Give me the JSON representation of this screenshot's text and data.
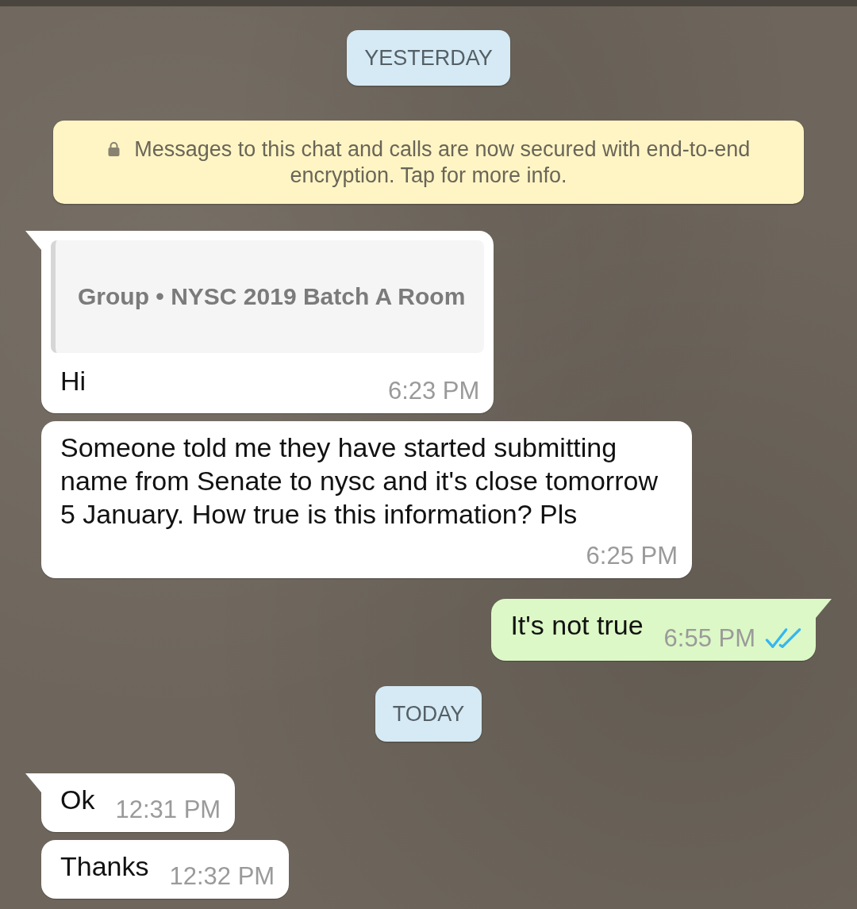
{
  "items": [
    {
      "kind": "date",
      "label": "YESTERDAY"
    },
    {
      "kind": "notice",
      "text": "Messages to this chat and calls are now secured with end-to-end encryption. Tap for more info."
    },
    {
      "kind": "message",
      "outgoing": false,
      "tail": true,
      "quote": "Group • NYSC 2019 Batch A Room",
      "text": "Hi",
      "time": "6:23 PM"
    },
    {
      "kind": "message",
      "outgoing": false,
      "tail": false,
      "text": "Someone told me they have started submitting name from Senate to nysc and it's close tomorrow 5 January. How true is this information? Pls",
      "time": "6:25 PM"
    },
    {
      "kind": "message",
      "outgoing": true,
      "tail": true,
      "text": "It's not true",
      "time": "6:55 PM",
      "read": true
    },
    {
      "kind": "date",
      "label": "TODAY"
    },
    {
      "kind": "message",
      "outgoing": false,
      "tail": true,
      "text": "Ok",
      "time": "12:31 PM"
    },
    {
      "kind": "message",
      "outgoing": false,
      "tail": false,
      "text": "Thanks",
      "time": "12:32 PM"
    }
  ]
}
